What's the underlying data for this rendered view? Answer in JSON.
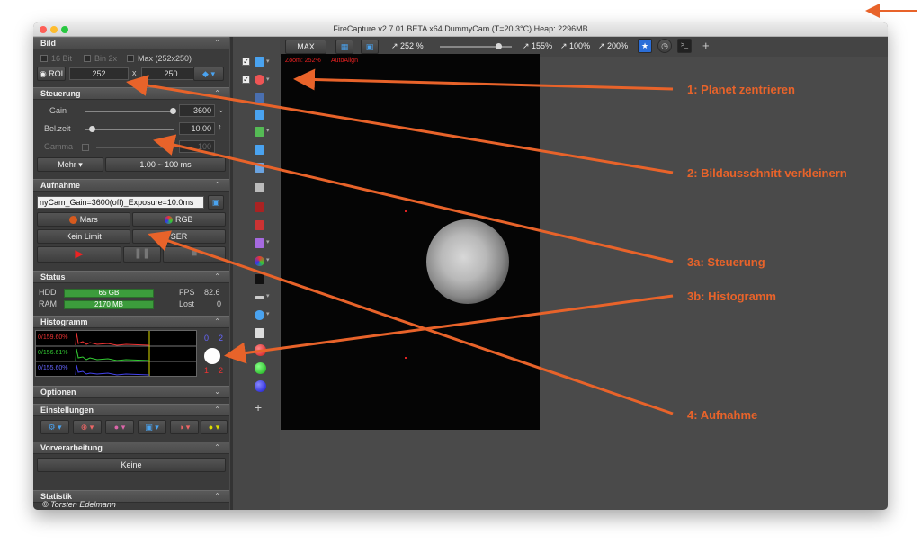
{
  "window": {
    "title": "FireCapture v2.7.01 BETA x64    DummyCam (T=20.3°C)    Heap: 2296MB"
  },
  "colors": {
    "accent": "#e8632a",
    "panel": "#3b3b3b",
    "green_bar": "#3c9c3c"
  },
  "bild": {
    "header": "Bild",
    "bit16": "16 Bit",
    "bin2x": "Bin 2x",
    "max": "Max (252x250)",
    "roi": "ROI",
    "width": "252",
    "x": "x",
    "height": "250"
  },
  "steuerung": {
    "header": "Steuerung",
    "gain_label": "Gain",
    "gain_value": "3600",
    "gain_level": 1.0,
    "exp_label": "Bel.zeit",
    "exp_value": "10.00",
    "exp_level": 0.05,
    "gamma_label": "Gamma",
    "gamma_value": "100",
    "mehr_label": "Mehr",
    "range": "1.00 ~ 100 ms"
  },
  "aufnahme": {
    "header": "Aufnahme",
    "filename": "nyCam_Gain=3600(off)_Exposure=10.0ms",
    "filter": "Mars",
    "color": "RGB",
    "limit": "Kein Limit",
    "format": "SER"
  },
  "status": {
    "header": "Status",
    "hdd_label": "HDD",
    "hdd_value": "65 GB",
    "ram_label": "RAM",
    "ram_value": "2170 MB",
    "fps_label": "FPS",
    "fps_value": "82.6",
    "lost_label": "Lost",
    "lost_value": "0"
  },
  "histogramm": {
    "header": "Histogramm",
    "red": "0/159.60%",
    "green": "0/156.61%",
    "blue": "0/155.60%",
    "v0": "0",
    "v2a": "2",
    "v1": "1",
    "v2b": "2"
  },
  "optionen": {
    "header": "Optionen"
  },
  "einstellungen": {
    "header": "Einstellungen"
  },
  "vorverarbeitung": {
    "header": "Vorverarbeitung",
    "value": "Keine"
  },
  "statistik": {
    "header": "Statistik"
  },
  "copyright": "© Torsten Edelmann",
  "toolbar": {
    "max": "MAX",
    "zoom": "252 %",
    "z155": "155%",
    "z100": "100%",
    "z200": "200%",
    "zoom_level": 0.8
  },
  "viewer": {
    "zoom_info": "Zoom: 252%",
    "autoalign": "AutoAlign"
  },
  "annotations": {
    "a1": "1: Planet zentrieren",
    "a2": "2: Bildausschnitt verkleinern",
    "a3a": "3a: Steuerung",
    "a3b": "3b: Histogramm",
    "a4": "4: Aufnahme"
  }
}
